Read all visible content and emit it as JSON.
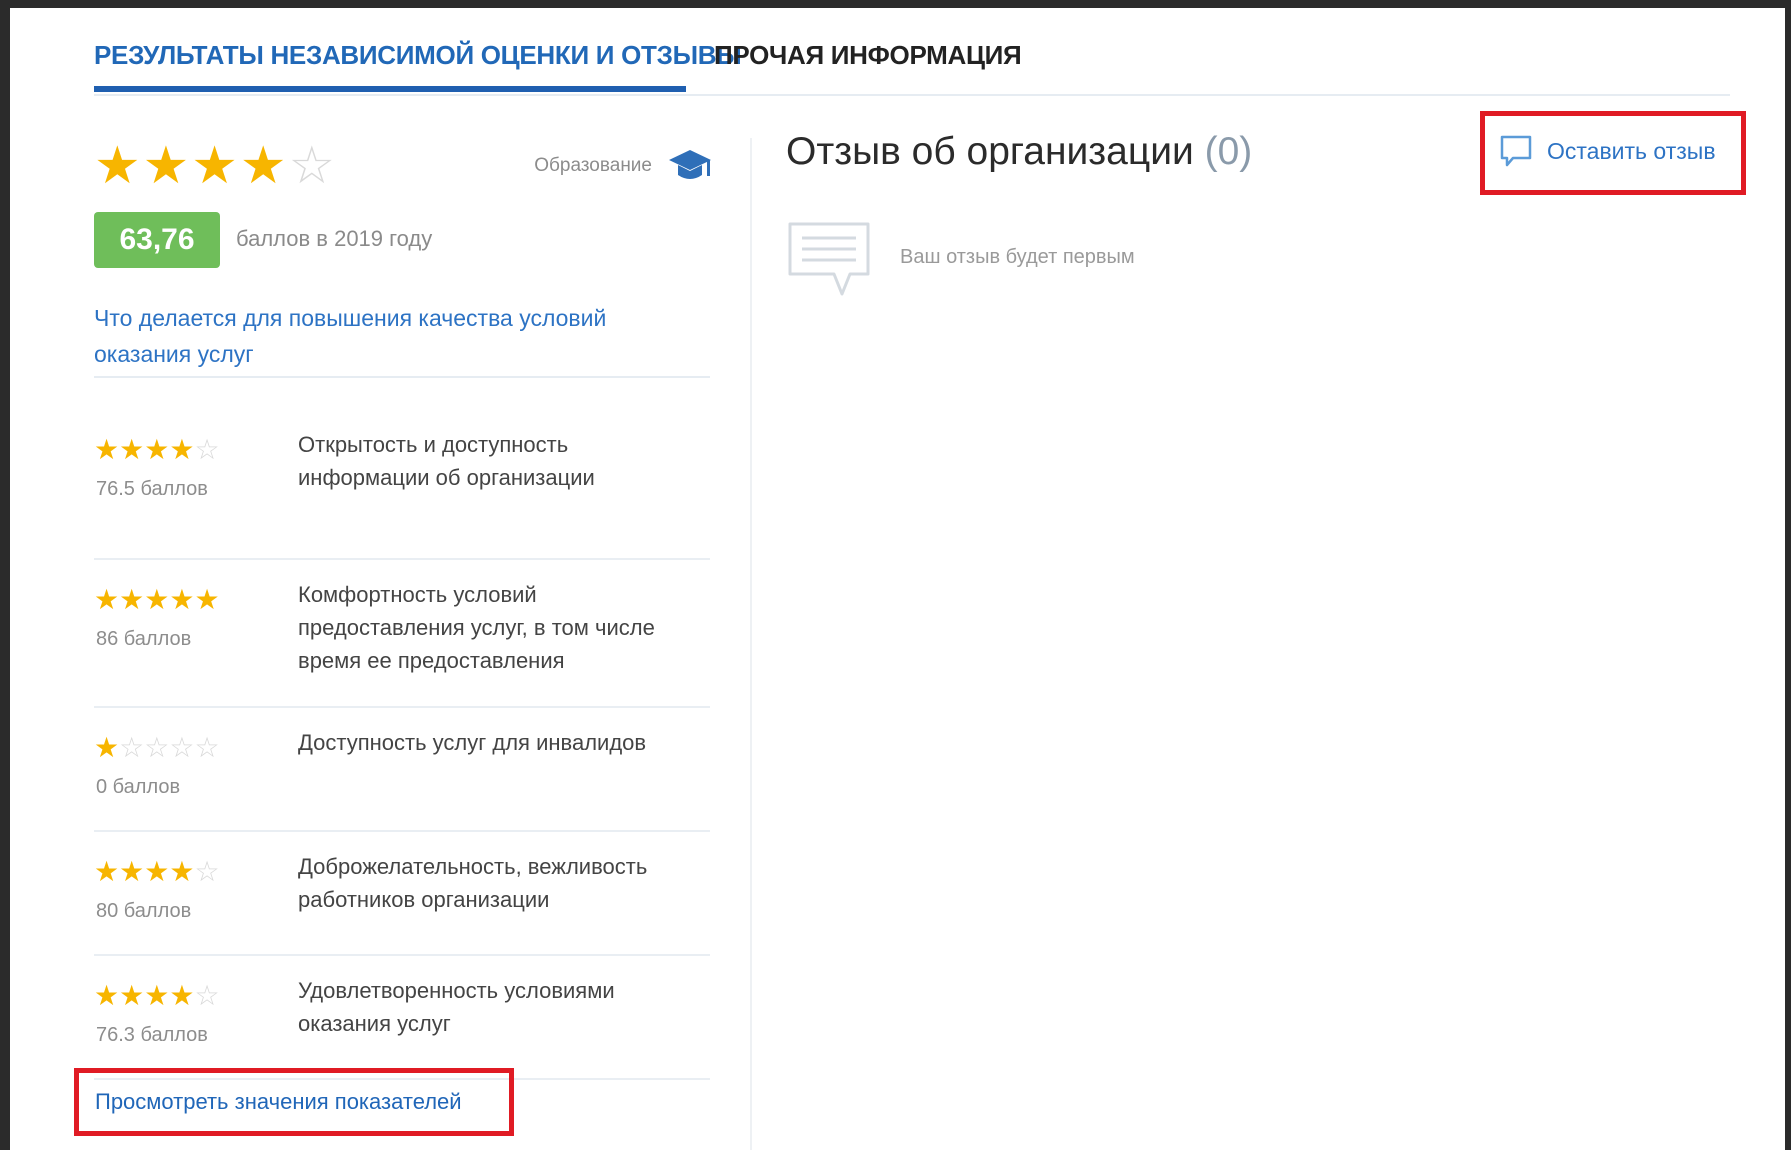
{
  "tabs": [
    {
      "label": "РЕЗУЛЬТАТЫ НЕЗАВИСИМОЙ ОЦЕНКИ И ОТЗЫВЫ",
      "active": true
    },
    {
      "label": "ПРОЧАЯ ИНФОРМАЦИЯ",
      "active": false
    }
  ],
  "rating": {
    "stars_filled": 4,
    "stars_total": 5,
    "category_label": "Образование",
    "category_icon": "graduation-cap-icon",
    "score": "63,76",
    "score_caption": "баллов в 2019 году",
    "improve_link": "Что делается для повышения качества условий оказания услуг"
  },
  "criteria": [
    {
      "stars": 4,
      "points": "76.5 баллов",
      "name": "Открытость и доступность информации об организации"
    },
    {
      "stars": 5,
      "points": "86 баллов",
      "name": "Комфортность условий предоставления услуг, в том числе время ее предоставления"
    },
    {
      "stars": 1,
      "points": "0 баллов",
      "name": "Доступность услуг для инвалидов"
    },
    {
      "stars": 4,
      "points": "80 баллов",
      "name": "Доброжелательность, вежливость работников организации"
    },
    {
      "stars": 4,
      "points": "76.3 баллов",
      "name": "Удовлетворенность условиями оказания услуг"
    }
  ],
  "view_link": "Просмотреть значения показателей",
  "reviews": {
    "title": "Отзыв об организации",
    "count": "(0)",
    "leave_label": "Оставить отзыв",
    "leave_icon": "comment-icon",
    "empty_icon": "chat-bubble-icon",
    "empty_text": "Ваш отзыв будет первым"
  },
  "colors": {
    "accent": "#2168b7",
    "star": "#f7b500",
    "score_bg": "#6fbe5a",
    "highlight": "#e01b24"
  }
}
